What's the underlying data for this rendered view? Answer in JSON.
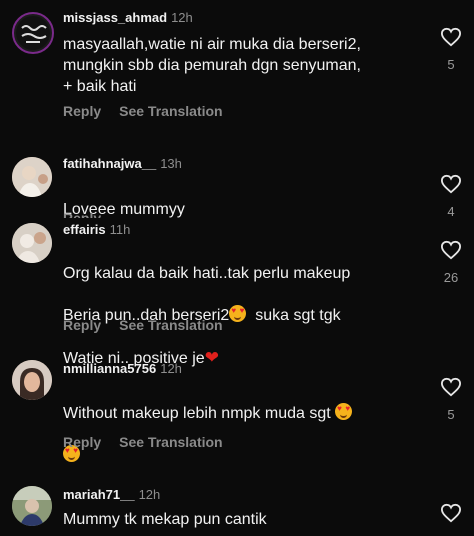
{
  "colors": {
    "background": "#0b0b0b",
    "text": "#f2f2f2",
    "muted": "#8e8e8e",
    "heart": "#e0201c"
  },
  "icons": {
    "like": "heart-outline-icon",
    "emoji_heart": "red-heart-emoji",
    "emoji_face": "smiling-face-with-heart-eyes-emoji"
  },
  "comments": [
    {
      "username": "missjass_ahmad",
      "time": "12h",
      "text": "masyaallah,watie ni air muka dia berseri2,\nmungkin sbb dia pemurah dgn senyuman,\n+ baik hati",
      "likes": "5",
      "reply": "Reply",
      "translate": "See Translation"
    },
    {
      "username": "fatihahnajwa__",
      "time": "13h",
      "text": "Loveee mummyy",
      "likes": "4",
      "reply": "Reply"
    },
    {
      "username": "effairis",
      "time": "11h",
      "text_line1": "Org kalau da baik hati..tak perlu makeup",
      "text_line2a": "Beria pun..dah berseri2",
      "text_line2b": "  suka sgt tgk",
      "text_line3": "Watie ni.. positive je",
      "likes": "26",
      "reply": "Reply",
      "translate": "See Translation"
    },
    {
      "username": "nmillianna5756",
      "time": "12h",
      "text": "Without makeup lebih nmpk muda sgt",
      "likes": "5",
      "reply": "Reply",
      "translate": "See Translation"
    },
    {
      "username": "mariah71__",
      "time": "12h",
      "text": "Mummy tk mekap pun cantik"
    }
  ]
}
